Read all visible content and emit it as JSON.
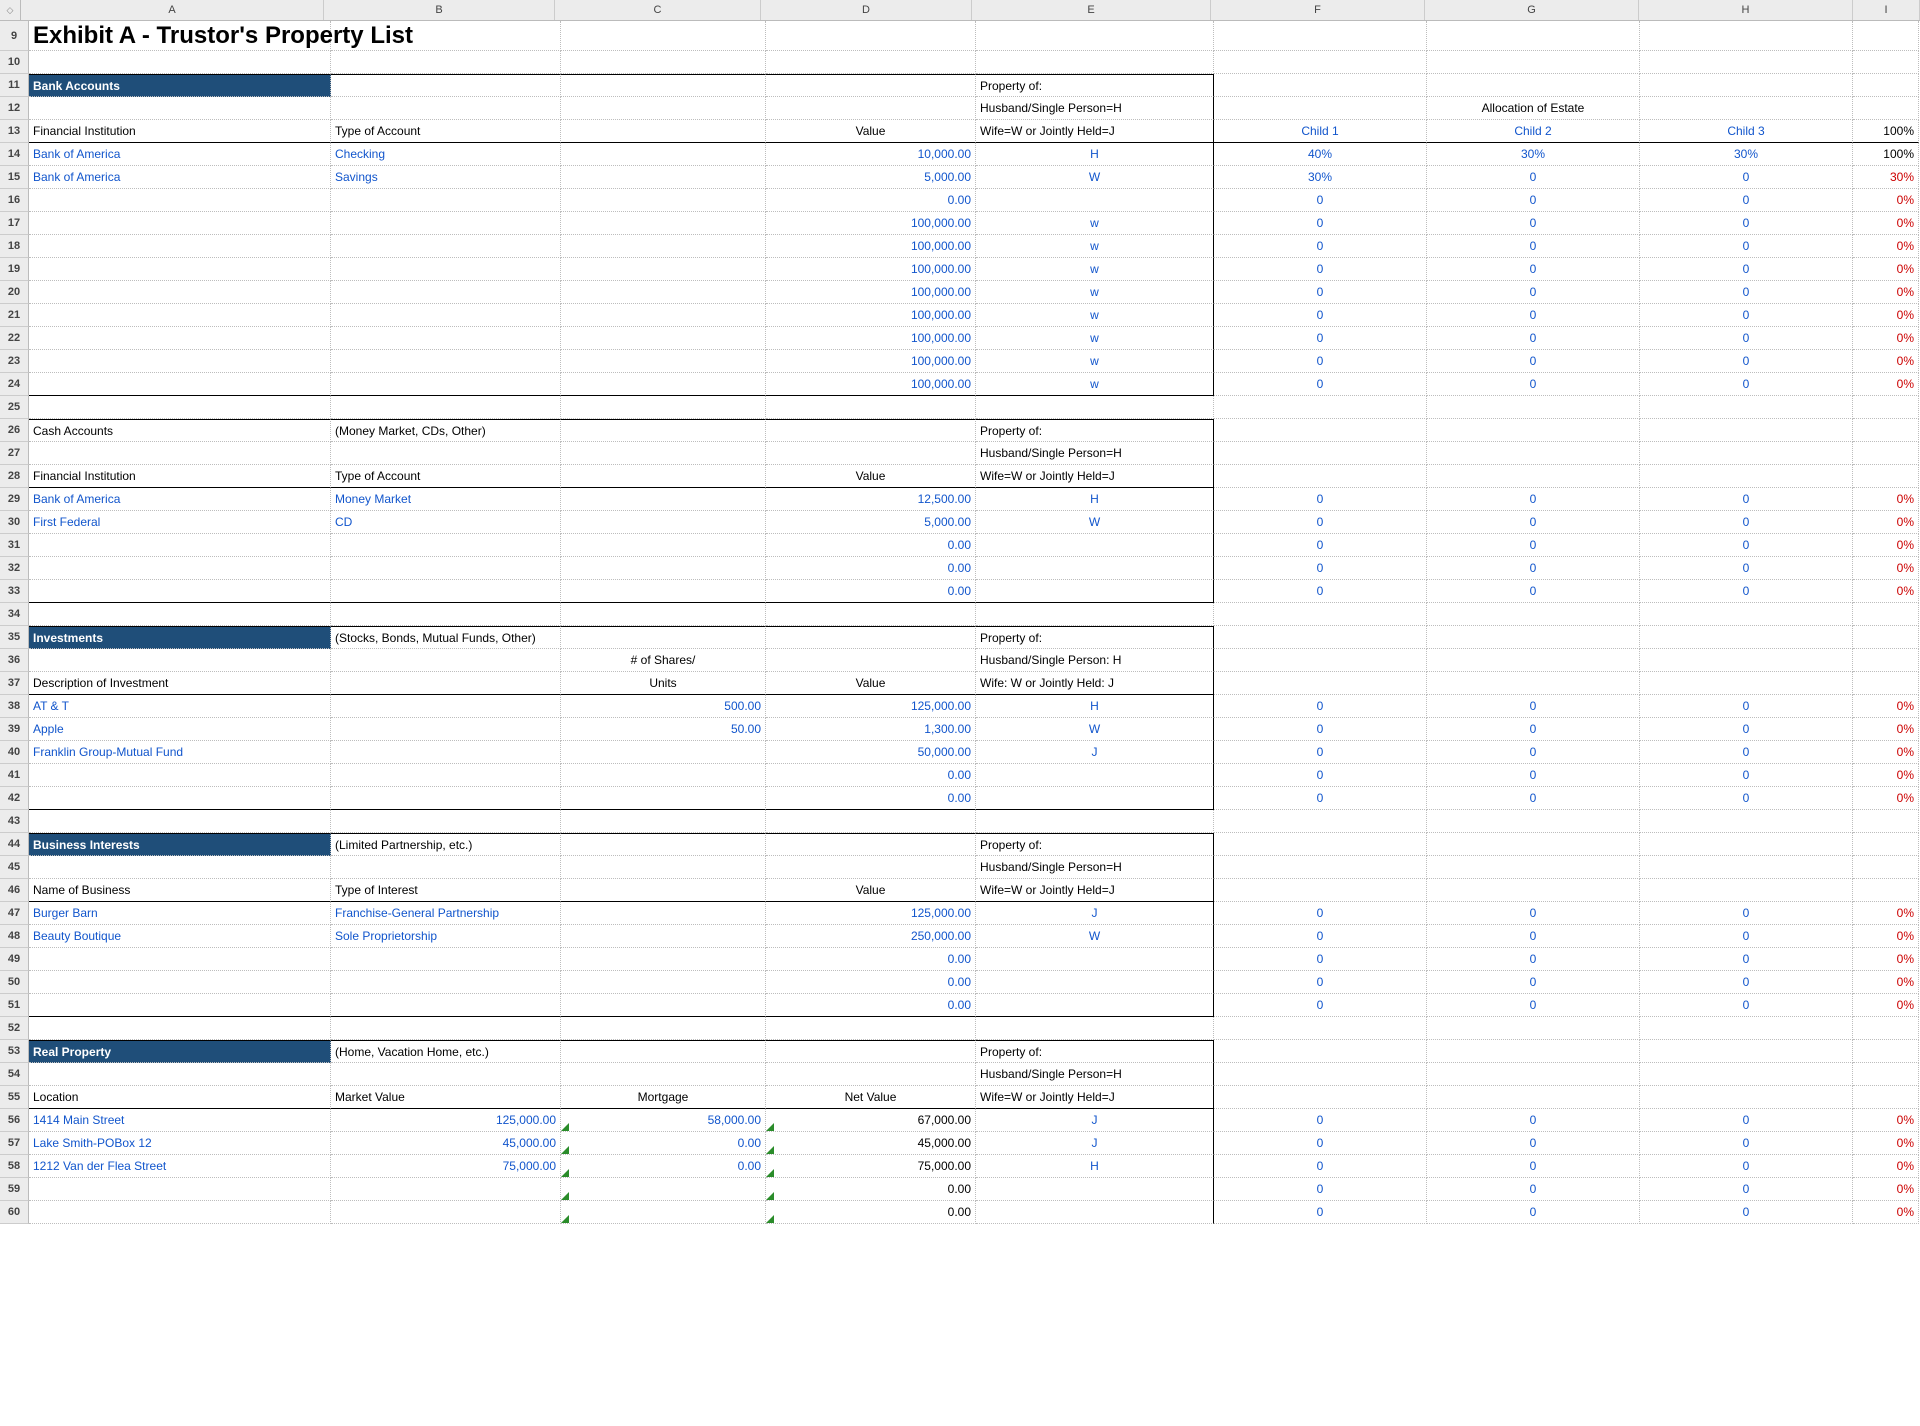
{
  "cols": [
    "A",
    "B",
    "C",
    "D",
    "E",
    "F",
    "G",
    "H",
    "I"
  ],
  "title": "Exhibit A - Trustor's Property List",
  "propOf": "Property of:",
  "propH": "Husband/Single Person=H",
  "propW": "Wife=W or Jointly Held=J",
  "propHc": "Husband/Single Person: H",
  "propWc": "Wife: W or Jointly Held: J",
  "alloc": "Allocation of Estate",
  "child1": "Child 1",
  "child2": "Child 2",
  "child3": "Child 3",
  "p100": "100%",
  "p30": "30%",
  "p0": "0%",
  "sec1": {
    "title": "Bank Accounts",
    "h1": "Financial Institution",
    "h2": "Type of Account",
    "h3": "Value"
  },
  "sec2": {
    "title": "Cash Accounts",
    "note": "(Money Market, CDs, Other)",
    "h1": "Financial Institution",
    "h2": "Type of Account",
    "h3": "Value"
  },
  "sec3": {
    "title": "Investments",
    "note": "(Stocks, Bonds, Mutual Funds, Other)",
    "h1": "Description of Investment",
    "h2a": "# of Shares/",
    "h2b": "Units",
    "h3": "Value"
  },
  "sec4": {
    "title": "Business Interests",
    "note": "(Limited Partnership, etc.)",
    "h1": "Name of Business",
    "h2": "Type of Interest",
    "h3": "Value"
  },
  "sec5": {
    "title": "Real Property",
    "note": "(Home, Vacation Home, etc.)",
    "h1": "Location",
    "h2": "Market Value",
    "h3": "Mortgage",
    "h4": "Net Value"
  },
  "r14": {
    "a": "Bank of America",
    "b": "Checking",
    "d": "10,000.00",
    "e": "H",
    "f": "40%",
    "g": "30%",
    "h": "30%",
    "i": "100%"
  },
  "r15": {
    "a": "Bank of America",
    "b": "Savings",
    "d": "5,000.00",
    "e": "W",
    "f": "30%",
    "g": "0",
    "h": "0",
    "i": "30%"
  },
  "r16": {
    "d": "0.00",
    "f": "0",
    "g": "0",
    "h": "0",
    "i": "0%"
  },
  "r17": {
    "d": "100,000.00",
    "e": "w",
    "f": "0",
    "g": "0",
    "h": "0",
    "i": "0%"
  },
  "r18": {
    "d": "100,000.00",
    "e": "w",
    "f": "0",
    "g": "0",
    "h": "0",
    "i": "0%"
  },
  "r19": {
    "d": "100,000.00",
    "e": "w",
    "f": "0",
    "g": "0",
    "h": "0",
    "i": "0%"
  },
  "r20": {
    "d": "100,000.00",
    "e": "w",
    "f": "0",
    "g": "0",
    "h": "0",
    "i": "0%"
  },
  "r21": {
    "d": "100,000.00",
    "e": "w",
    "f": "0",
    "g": "0",
    "h": "0",
    "i": "0%"
  },
  "r22": {
    "d": "100,000.00",
    "e": "w",
    "f": "0",
    "g": "0",
    "h": "0",
    "i": "0%"
  },
  "r23": {
    "d": "100,000.00",
    "e": "w",
    "f": "0",
    "g": "0",
    "h": "0",
    "i": "0%"
  },
  "r24": {
    "d": "100,000.00",
    "e": "w",
    "f": "0",
    "g": "0",
    "h": "0",
    "i": "0%"
  },
  "r29": {
    "a": "Bank of America",
    "b": "Money Market",
    "d": "12,500.00",
    "e": "H",
    "f": "0",
    "g": "0",
    "h": "0",
    "i": "0%"
  },
  "r30": {
    "a": "First Federal",
    "b": "CD",
    "d": "5,000.00",
    "e": "W",
    "f": "0",
    "g": "0",
    "h": "0",
    "i": "0%"
  },
  "r31": {
    "d": "0.00",
    "f": "0",
    "g": "0",
    "h": "0",
    "i": "0%"
  },
  "r32": {
    "d": "0.00",
    "f": "0",
    "g": "0",
    "h": "0",
    "i": "0%"
  },
  "r33": {
    "d": "0.00",
    "f": "0",
    "g": "0",
    "h": "0",
    "i": "0%"
  },
  "r38": {
    "a": "AT & T",
    "c": "500.00",
    "d": "125,000.00",
    "e": "H",
    "f": "0",
    "g": "0",
    "h": "0",
    "i": "0%"
  },
  "r39": {
    "a": "Apple",
    "c": "50.00",
    "d": "1,300.00",
    "e": "W",
    "f": "0",
    "g": "0",
    "h": "0",
    "i": "0%"
  },
  "r40": {
    "a": "Franklin Group-Mutual Fund",
    "d": "50,000.00",
    "e": "J",
    "f": "0",
    "g": "0",
    "h": "0",
    "i": "0%"
  },
  "r41": {
    "d": "0.00",
    "f": "0",
    "g": "0",
    "h": "0",
    "i": "0%"
  },
  "r42": {
    "d": "0.00",
    "f": "0",
    "g": "0",
    "h": "0",
    "i": "0%"
  },
  "r47": {
    "a": "Burger Barn",
    "b": "Franchise-General Partnership",
    "d": "125,000.00",
    "e": "J",
    "f": "0",
    "g": "0",
    "h": "0",
    "i": "0%"
  },
  "r48": {
    "a": "Beauty Boutique",
    "b": "Sole Proprietorship",
    "d": "250,000.00",
    "e": "W",
    "f": "0",
    "g": "0",
    "h": "0",
    "i": "0%"
  },
  "r49": {
    "d": "0.00",
    "f": "0",
    "g": "0",
    "h": "0",
    "i": "0%"
  },
  "r50": {
    "d": "0.00",
    "f": "0",
    "g": "0",
    "h": "0",
    "i": "0%"
  },
  "r51": {
    "d": "0.00",
    "f": "0",
    "g": "0",
    "h": "0",
    "i": "0%"
  },
  "r56": {
    "a": "1414 Main Street",
    "b": "125,000.00",
    "c": "58,000.00",
    "d": "67,000.00",
    "e": "J",
    "f": "0",
    "g": "0",
    "h": "0",
    "i": "0%"
  },
  "r57": {
    "a": "Lake Smith-POBox 12",
    "b": "45,000.00",
    "c": "0.00",
    "d": "45,000.00",
    "e": "J",
    "f": "0",
    "g": "0",
    "h": "0",
    "i": "0%"
  },
  "r58": {
    "a": "1212 Van der Flea Street",
    "b": "75,000.00",
    "c": "0.00",
    "d": "75,000.00",
    "e": "H",
    "f": "0",
    "g": "0",
    "h": "0",
    "i": "0%"
  },
  "r59": {
    "d": "0.00",
    "f": "0",
    "g": "0",
    "h": "0",
    "i": "0%"
  },
  "r60": {
    "d": "0.00",
    "f": "0",
    "g": "0",
    "h": "0",
    "i": "0%"
  }
}
